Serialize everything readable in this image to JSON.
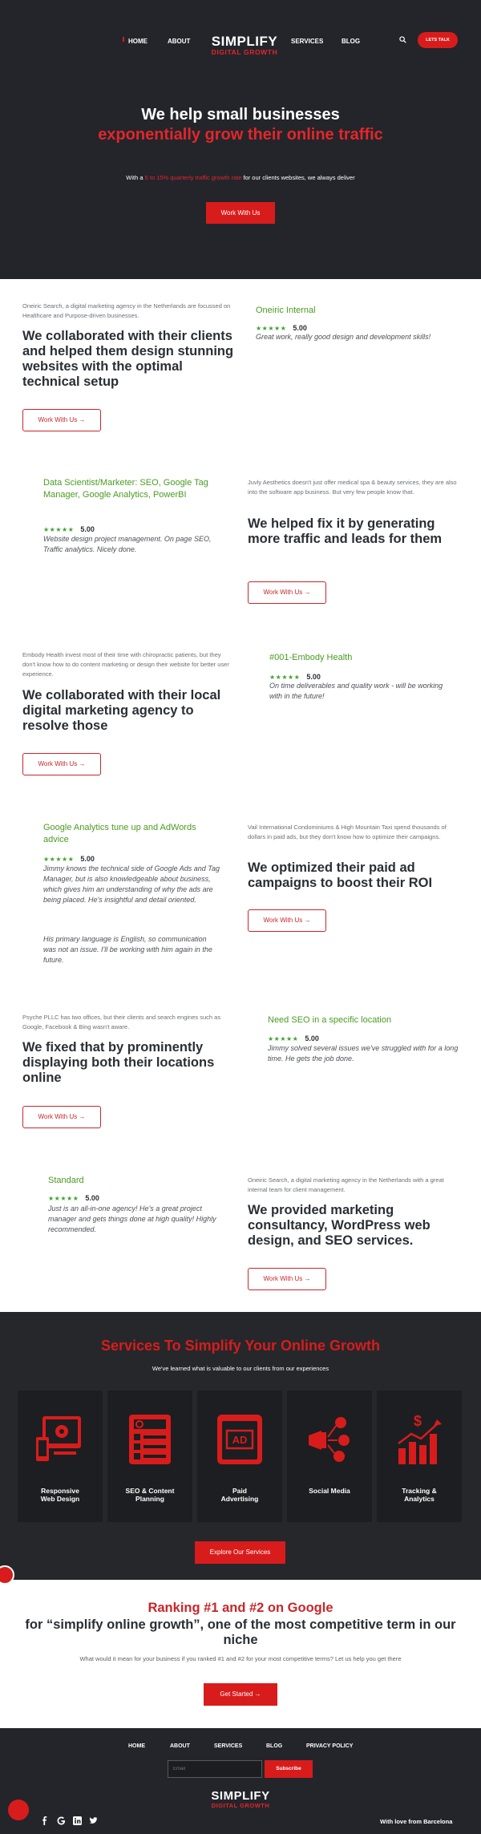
{
  "nav": {
    "home": "HOME",
    "about": "ABOUT",
    "services": "SERVICES",
    "blog": "BLOG",
    "cta": "LETS TALK",
    "brand_main": "SIMPLIFY",
    "brand_sub": "DIGITAL GROWTH"
  },
  "hero": {
    "line1": "We help small businesses",
    "line2": "exponentially grow their online traffic",
    "sub_pre": "With a ",
    "sub_highlight": "5 to 15% quarterly traffic growth rate",
    "sub_post": " for our clients websites, we always deliver",
    "cta": "Work With Us"
  },
  "cases": [
    {
      "intro": "Oneiric Search, a digital marketing agency in the Netherlands are focussed on Healthcare and Purpose-driven businesses.",
      "headline": "We collaborated with their clients and helped them design stunning websites with the optimal technical setup",
      "button": "Work With Us  →",
      "review_title": "Oneiric Internal",
      "stars": "★★★★★",
      "score": "5.00",
      "review": "Great work, really good design and development skills!"
    },
    {
      "intro": "Juvly Aesthetics doesn't just offer medical spa & beauty services, they are also into the software app business. But very few people know that.",
      "headline": "We helped fix it by generating more traffic and leads for them",
      "button": "Work With Us  →",
      "review_title": "Data Scientist/Marketer: SEO, Google Tag Manager, Google Analytics, PowerBI",
      "stars": "★★★★★",
      "score": "5.00",
      "review": "Website design project management. On page SEO, Traffic analytics. Nicely done."
    },
    {
      "intro": "Embody Health invest most of their time with chiropractic patients, but they don't know how to do content marketing or design their website for better user experience.",
      "headline": "We collaborated with their local digital marketing agency to resolve those",
      "button": "Work With Us  →",
      "review_title": "#001-Embody Health",
      "stars": "★★★★★",
      "score": "5.00",
      "review": "On time deliverables and quality work - will be working with in the future!"
    },
    {
      "intro": "Vail International Condominiums & High Mountain Taxi spend thousands of dollars in paid ads, but they don't know how to optimize their campaigns.",
      "headline": "We optimized their paid ad campaigns to boost their ROI",
      "button": "Work With Us  →",
      "review_title": "Google Analytics tune up and AdWords advice",
      "stars": "★★★★★",
      "score": "5.00",
      "review": "Jimmy knows the technical side of Google Ads and Tag Manager, but is also knowledgeable about business, which gives him an understanding of why the ads are being placed. He's insightful and detail oriented.",
      "review2": "His primary language is English, so communication was not an issue. I'll be working with him again in the future."
    },
    {
      "intro": "Psyche PLLC has two offices, but their clients and search engines such as Google, Facebook & Bing wasn't aware.",
      "headline": "We fixed that by prominently displaying both their locations online",
      "button": "Work With Us  →",
      "review_title": "Need SEO in a specific location",
      "stars": "★★★★★",
      "score": "5.00",
      "review": "Jimmy solved several issues we've struggled with for a long time. He gets the job done."
    },
    {
      "intro": "Oneiric Search, a digital marketing agency in the Netherlands with a great internal team for client management.",
      "headline": "We provided marketing consultancy, WordPress web design, and SEO services.",
      "button": "Work With Us  →",
      "review_title": "Standard",
      "stars": "★★★★★",
      "score": "5.00",
      "review": "Just is an all-in-one agency! He's a great project manager and gets things done at high quality! Highly recommended."
    }
  ],
  "services": {
    "title": "Services To Simplify Your Online Growth",
    "subtitle": "We've learned what is valuable to our clients from our experiences",
    "items": [
      {
        "label1": "Responsive",
        "label2": "Web Design",
        "icon": "responsive-design-icon"
      },
      {
        "label1": "SEO & Content",
        "label2": "Planning",
        "icon": "seo-content-icon"
      },
      {
        "label1": "Paid",
        "label2": "Advertising",
        "icon": "ad-icon"
      },
      {
        "label1": "Social Media",
        "label2": "",
        "icon": "social-media-icon"
      },
      {
        "label1": "Tracking &",
        "label2": "Analytics",
        "icon": "analytics-icon"
      }
    ],
    "button": "Explore Our Services",
    "ad_text": "AD"
  },
  "ranking": {
    "line1": "Ranking #1 and #2 on Google",
    "line2": "for “simplify online growth”, one of the most competitive term in our niche",
    "subtitle": "What would it mean for your business if you ranked #1 and #2 for your most competitive terms? Let us help you get there",
    "button": "Get Started  →"
  },
  "footer": {
    "links": [
      "HOME",
      "ABOUT",
      "SERVICES",
      "BLOG",
      "PRIVACY POLICY"
    ],
    "email_placeholder": "Email",
    "subscribe": "Subscribe",
    "brand_main": "SIMPLIFY",
    "brand_sub": "DIGITAL GROWTH",
    "tagline": "With love from Barcelona"
  },
  "colors": {
    "accent": "#d81c1c",
    "dark": "#23252a",
    "green": "#4a9b21"
  }
}
